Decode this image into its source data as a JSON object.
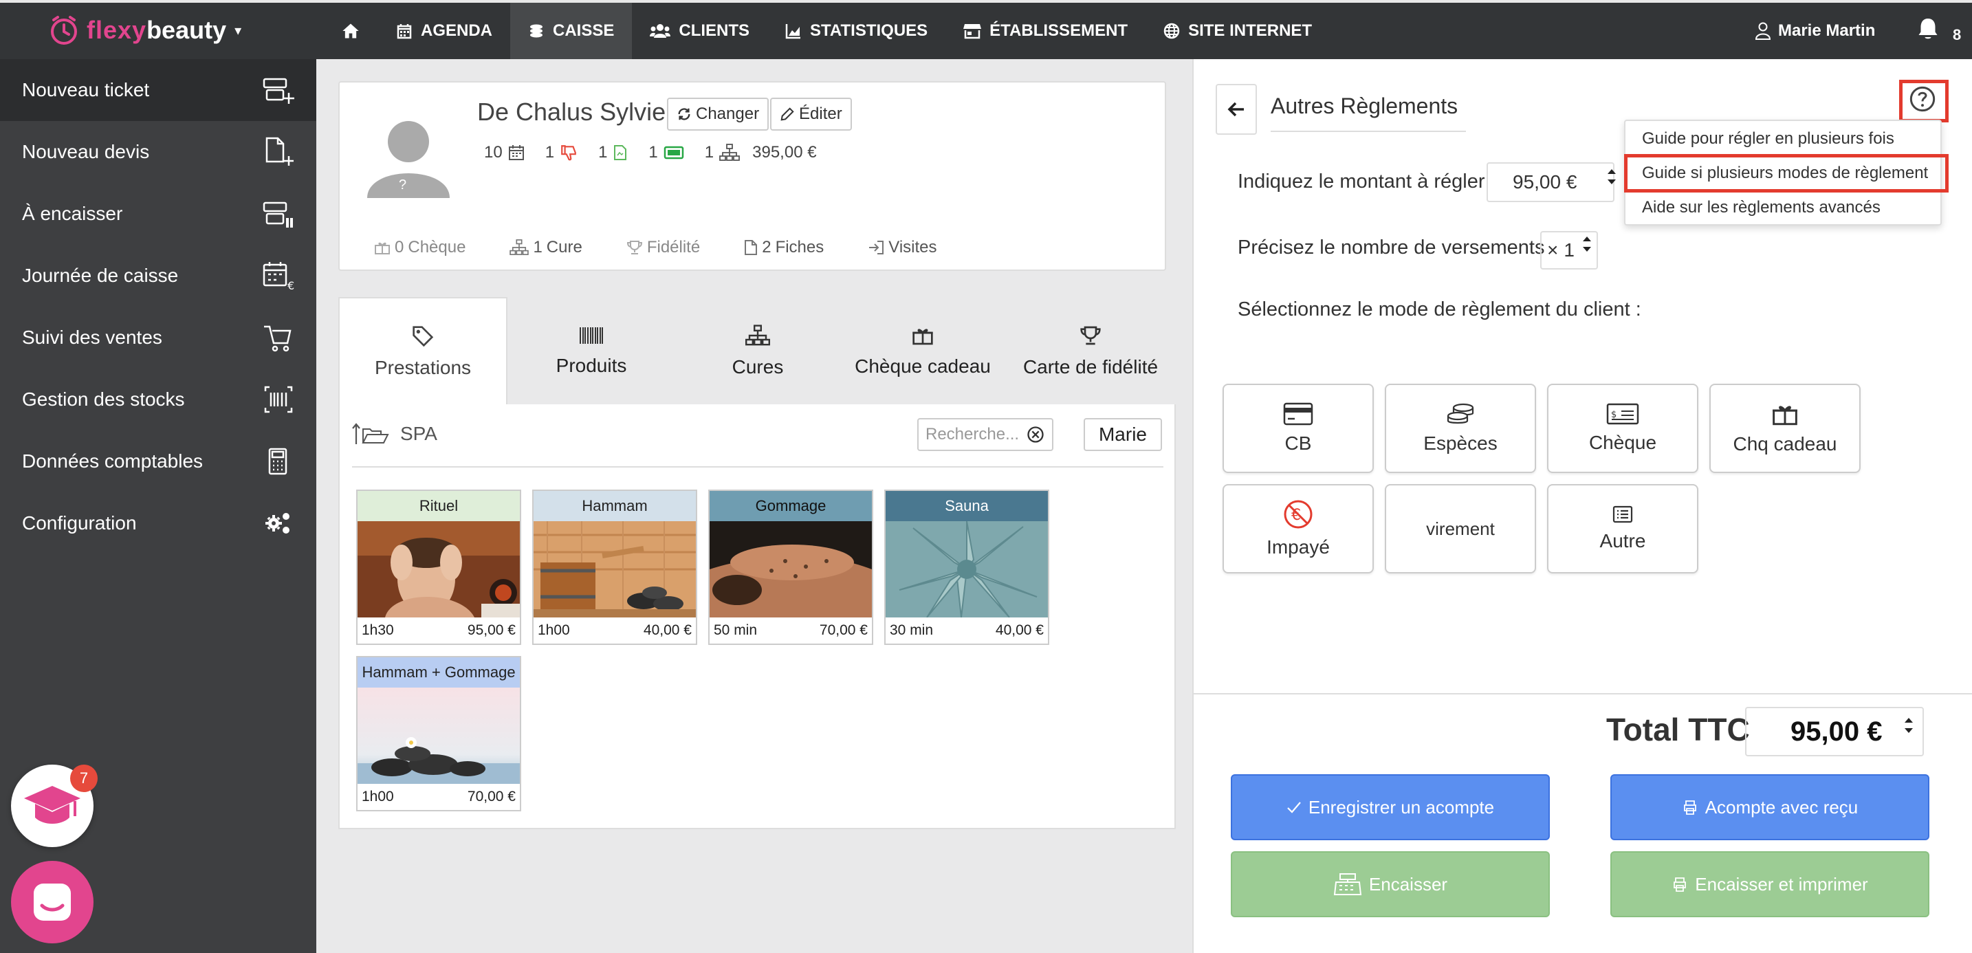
{
  "brand": {
    "part1": "flexy",
    "part2": "beauty",
    "accent": "#e2458e"
  },
  "nav": {
    "home_icon": "home-icon",
    "items": [
      {
        "label": "AGENDA",
        "icon": "calendar-icon"
      },
      {
        "label": "CAISSE",
        "icon": "cash-register-icon",
        "active": true
      },
      {
        "label": "CLIENTS",
        "icon": "users-icon"
      },
      {
        "label": "STATISTIQUES",
        "icon": "chart-icon"
      },
      {
        "label": "ÉTABLISSEMENT",
        "icon": "store-icon"
      },
      {
        "label": "SITE INTERNET",
        "icon": "globe-icon"
      }
    ],
    "user": "Marie Martin",
    "notifications": "8"
  },
  "sidebar": {
    "items": [
      {
        "label": "Nouveau ticket",
        "active": true
      },
      {
        "label": "Nouveau devis"
      },
      {
        "label": "À encaisser"
      },
      {
        "label": "Journée de caisse"
      },
      {
        "label": "Suivi des ventes"
      },
      {
        "label": "Gestion des stocks"
      },
      {
        "label": "Données comptables"
      },
      {
        "label": "Configuration"
      }
    ],
    "academy_badge": "7"
  },
  "client": {
    "name": "De Chalus Sylvie",
    "change_label": "Changer",
    "edit_label": "Éditer",
    "avatar_mark": "?",
    "stats": {
      "visits": "10",
      "dislikes": "1",
      "documents": "1",
      "cards": "1",
      "cures": "1",
      "amount": "395,00 €"
    },
    "chips": [
      {
        "count": "0",
        "label": "Chèque"
      },
      {
        "count": "1",
        "label": "Cure"
      },
      {
        "count": "",
        "label": "Fidélité"
      },
      {
        "count": "2",
        "label": "Fiches"
      },
      {
        "count": "",
        "label": "Visites"
      }
    ]
  },
  "tabs": [
    {
      "label": "Prestations",
      "active": true
    },
    {
      "label": "Produits"
    },
    {
      "label": "Cures"
    },
    {
      "label": "Chèque cadeau"
    },
    {
      "label": "Carte de fidélité"
    }
  ],
  "catalog": {
    "folder": "SPA",
    "search_placeholder": "Recherche...",
    "staff": "Marie",
    "items": [
      {
        "title": "Rituel",
        "duration": "1h30",
        "price": "95,00 €",
        "color": "#dfeed9"
      },
      {
        "title": "Hammam",
        "duration": "1h00",
        "price": "40,00 €",
        "color": "#d3e0ea"
      },
      {
        "title": "Gommage",
        "duration": "50 min",
        "price": "70,00 €",
        "color": "#6f9db1"
      },
      {
        "title": "Sauna",
        "duration": "30 min",
        "price": "40,00 €",
        "color": "#4a7890"
      },
      {
        "title": "Hammam + Gommage",
        "duration": "1h00",
        "price": "70,00 €",
        "color": "#b8cdf2"
      }
    ]
  },
  "payment": {
    "title": "Autres Règlements",
    "help_menu": [
      "Guide pour régler en plusieurs fois",
      "Guide si plusieurs modes de règlement",
      "Aide sur les règlements avancés"
    ],
    "amount_label": "Indiquez le montant à régler",
    "amount_value": "95,00 €",
    "installments_label": "Précisez le nombre de versements",
    "installments_prefix": "×",
    "installments_value": "1",
    "mode_label": "Sélectionnez le mode de règlement du client :",
    "modes": [
      {
        "label": "CB",
        "icon": "credit-card-icon"
      },
      {
        "label": "Espèces",
        "icon": "coins-icon"
      },
      {
        "label": "Chèque",
        "icon": "cheque-icon"
      },
      {
        "label": "Chq cadeau",
        "icon": "gift-icon"
      },
      {
        "label": "Impayé",
        "icon": "unpaid-icon"
      },
      {
        "label": "virement",
        "icon": ""
      },
      {
        "label": "Autre",
        "icon": "list-icon"
      }
    ],
    "total_label": "Total TTC",
    "total_value": "95,00 €",
    "actions": {
      "deposit": "Enregistrer un acompte",
      "deposit_receipt": "Acompte avec reçu",
      "cash_in": "Encaisser",
      "cash_in_print": "Encaisser et imprimer"
    }
  }
}
